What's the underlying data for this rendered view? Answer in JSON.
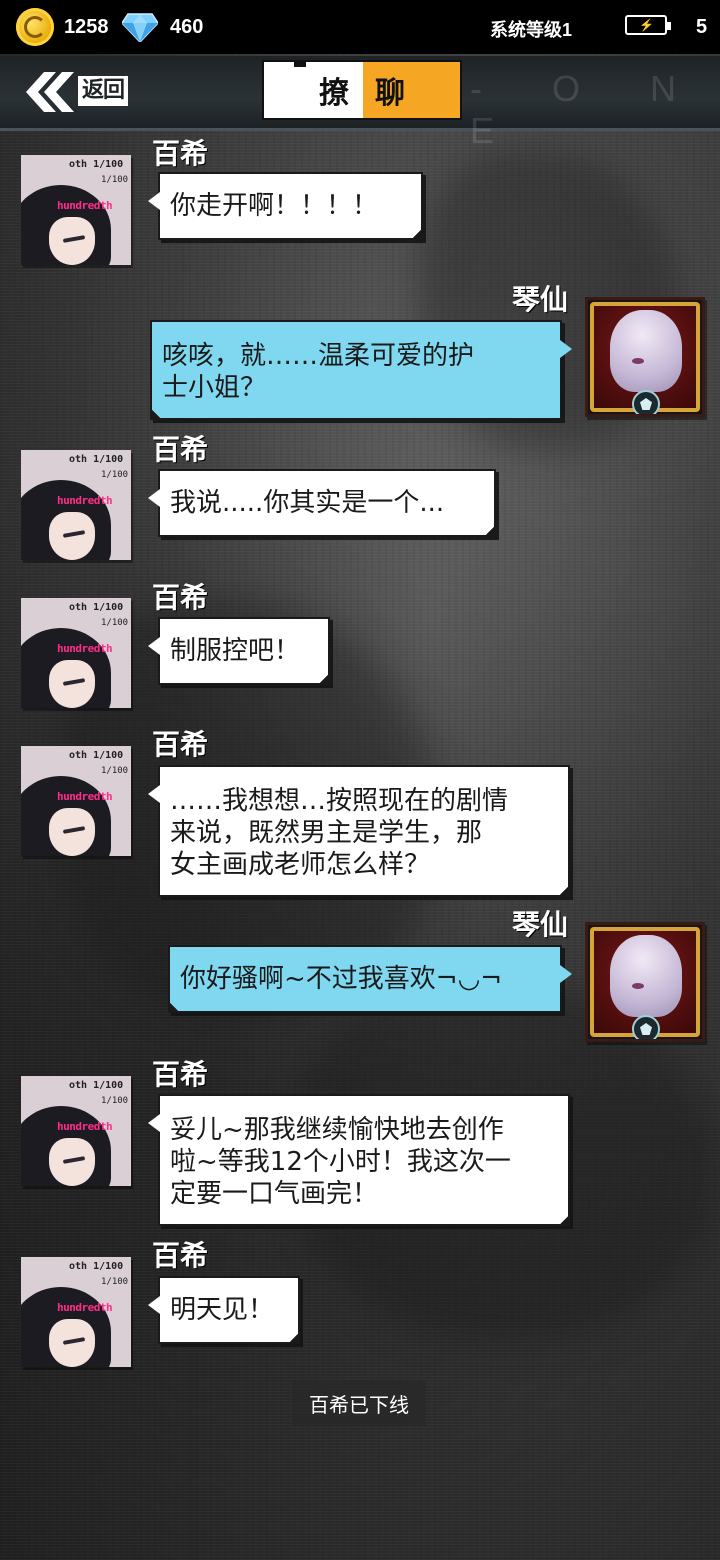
{
  "status_bar": {
    "coin_count": "1258",
    "gem_count": "460",
    "system_level": "系统等级1",
    "energy_count": "5",
    "icons": {
      "coin": "coin-icon",
      "gem": "gem-icon",
      "energy": "energy-icon"
    }
  },
  "header": {
    "back_label": "返回",
    "title_left": "撩",
    "title_right": "聊",
    "watermark": "- O N E",
    "accent_color": "#f5a623"
  },
  "chat": {
    "messages": [
      {
        "sender": "百希",
        "side": "left",
        "text": "你走开啊！！！！"
      },
      {
        "sender": "琴仙",
        "side": "right",
        "lines": [
          "咳咳，就……温柔可爱的护",
          "士小姐？"
        ]
      },
      {
        "sender": "百希",
        "side": "left",
        "text": "我说.....你其实是一个..."
      },
      {
        "sender": "百希",
        "side": "left",
        "text": "制服控吧！"
      },
      {
        "sender": "百希",
        "side": "left",
        "lines": [
          "……我想想…按照现在的剧情",
          "来说，既然男主是学生，那",
          "女主画成老师怎么样？"
        ]
      },
      {
        "sender": "琴仙",
        "side": "right",
        "text": "你好骚啊~不过我喜欢¬◡¬"
      },
      {
        "sender": "百希",
        "side": "left",
        "lines": [
          "妥儿~那我继续愉快地去创作",
          "啦~等我12个小时！我这次一",
          "定要一口气画完！"
        ]
      },
      {
        "sender": "百希",
        "side": "left",
        "text": "明天见！"
      }
    ],
    "system_notice": "百希已下线",
    "bubble_colors": {
      "left": "#ffffff",
      "right": "#7fd8f0"
    }
  }
}
